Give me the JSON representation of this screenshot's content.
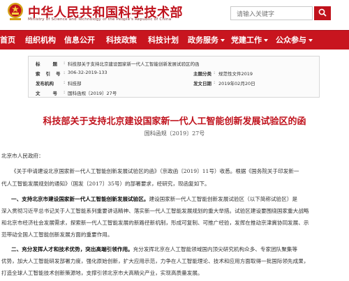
{
  "header": {
    "title": "中华人民共和国科学技术部",
    "subtitle": "Ministry of Science and Technology of the People's Republic of China",
    "emblem_icon": "national-emblem-icon",
    "search_placeholder": "请输入关键字",
    "search_icon": "search-icon"
  },
  "nav": {
    "items": [
      {
        "label": "首页"
      },
      {
        "label": "组织机构"
      },
      {
        "label": "信息公开"
      },
      {
        "label": "科技政策"
      },
      {
        "label": "科技计划"
      },
      {
        "label": "政务服务"
      },
      {
        "label": "党建工作"
      },
      {
        "label": "公众参与"
      }
    ]
  },
  "meta": {
    "title_label": "标题",
    "title_value": "科技部关于支持北京建设国家新一代人工智能创新发展试验区的函",
    "index_label": "索引号",
    "index_value": "306-32-2019-133",
    "category_label": "主题分类",
    "category_value": "规范性文件2019",
    "issuer_label": "发布机构",
    "issuer_value": "科技部",
    "date_label": "发文日期",
    "date_value": "2019年02月20日",
    "docno_label": "文号",
    "docno_value": "国科函规〔2019〕27号"
  },
  "document": {
    "title": "科技部关于支持北京建设国家新一代人工智能创新发展试验区的函",
    "number": "国科函规〔2019〕27号",
    "salutation": "北京市人民政府：",
    "para1_line1": "《关于申请建设北京国家新一代人工智能创新发展试验区的函》（京政函〔2019〕11号）收悉。根据《国务院关于印发新一",
    "para1_line2": "代人工智能发展规划的通知》（国发〔2017〕35号）的部署要求，经研究，现函复如下。",
    "para2_heading": "一、支持北京市建设国家新一代人工智能创新发展试验区。",
    "para2_line1_rest": "建设国家新一代人工智能创新发展试验区（以下简称试验区）是",
    "para2_line2": "深入贯彻习近平总书记关于人工智能系列重要讲话精神、落实新一代人工智能发展规划的重大举措。试验区建设要围绕国家重大战略",
    "para2_line3": "和北京市经济社会发展需求，探索新一代人工智能发展的新路径新机制，形成可复制、可推广经验，发挥在推动京津冀协同发展、示",
    "para2_line4": "范带动全国人工智能创新发展方面的重要作用。",
    "para3_heading": "二、充分发挥人才和技术优势，突出高端引领作用。",
    "para3_line1_rest": "充分发挥北京在人工智能领域国内顶尖研究机构众多、专家团队聚集等",
    "para3_line2": "优势，加大人工智能研发部署力度，强化原始创新，扩大应用示范，力争在人工智能理论、技术和应用方面取得一批国际领先成果，",
    "para3_line3": "打造全球人工智能技术创新策源地，支撑引领北京市大高精尖产业，实现高质量发展。"
  }
}
